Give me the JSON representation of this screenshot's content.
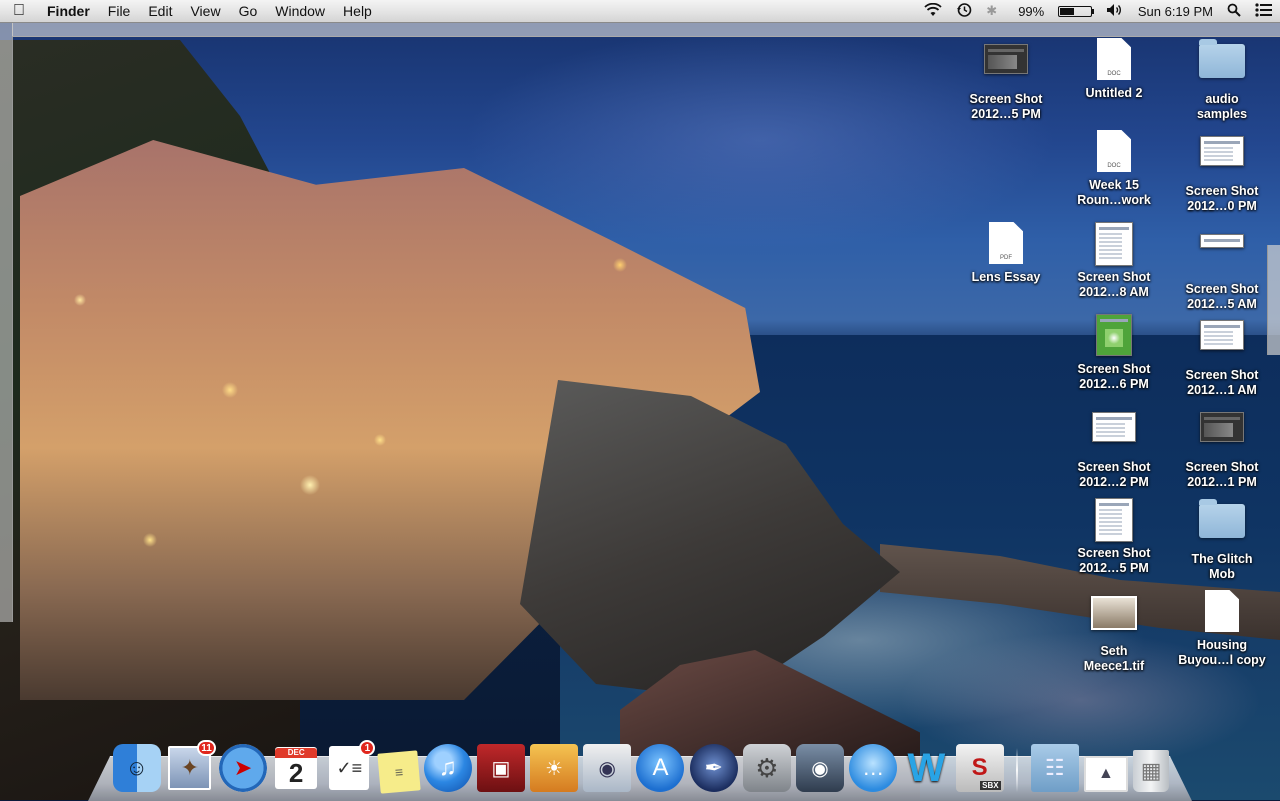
{
  "menubar": {
    "apple_icon": "apple-logo-icon",
    "app_name": "Finder",
    "menus": [
      "File",
      "Edit",
      "View",
      "Go",
      "Window",
      "Help"
    ],
    "status": {
      "battery_percent": "99%",
      "battery_level": 0.99,
      "clock": "Sun 6:19 PM"
    }
  },
  "desktop_icons": [
    {
      "label_1": "Screen Shot",
      "label_2": "2012…5 PM",
      "kind": "screenshot"
    },
    {
      "label_1": "Untitled 2",
      "label_2": "",
      "kind": "doc",
      "badge": "DOC"
    },
    {
      "label_1": "audio",
      "label_2": "samples",
      "kind": "folder"
    },
    {
      "label_1": "Week 15",
      "label_2": "Roun…work",
      "kind": "doc",
      "badge": "DOC"
    },
    {
      "label_1": "Screen Shot",
      "label_2": "2012…0 PM",
      "kind": "screenshot"
    },
    {
      "label_1": "Lens Essay",
      "label_2": "",
      "kind": "doc",
      "badge": "PDF"
    },
    {
      "label_1": "Screen Shot",
      "label_2": "2012…8 AM",
      "kind": "screenshot-tall"
    },
    {
      "label_1": "Screen Shot",
      "label_2": "2012…5 AM",
      "kind": "screenshot"
    },
    {
      "label_1": "Screen Shot",
      "label_2": "2012…6 PM",
      "kind": "screenshot-green"
    },
    {
      "label_1": "Screen Shot",
      "label_2": "2012…1 AM",
      "kind": "screenshot"
    },
    {
      "label_1": "Screen Shot",
      "label_2": "2012…2 PM",
      "kind": "screenshot"
    },
    {
      "label_1": "Screen Shot",
      "label_2": "2012…1 PM",
      "kind": "screenshot-dark"
    },
    {
      "label_1": "Screen Shot",
      "label_2": "2012…5 PM",
      "kind": "screenshot-tall"
    },
    {
      "label_1": "The Glitch",
      "label_2": "Mob",
      "kind": "folder"
    },
    {
      "label_1": "Seth",
      "label_2": "Meece1.tif",
      "kind": "photo"
    },
    {
      "label_1": "Housing",
      "label_2": "Buyou…l copy",
      "kind": "doc",
      "badge": ""
    }
  ],
  "dock": {
    "mail_badge": "11",
    "calendar_month": "DEC",
    "calendar_day": "2",
    "reminders_badge": "1",
    "sbx_label": "SBX"
  }
}
